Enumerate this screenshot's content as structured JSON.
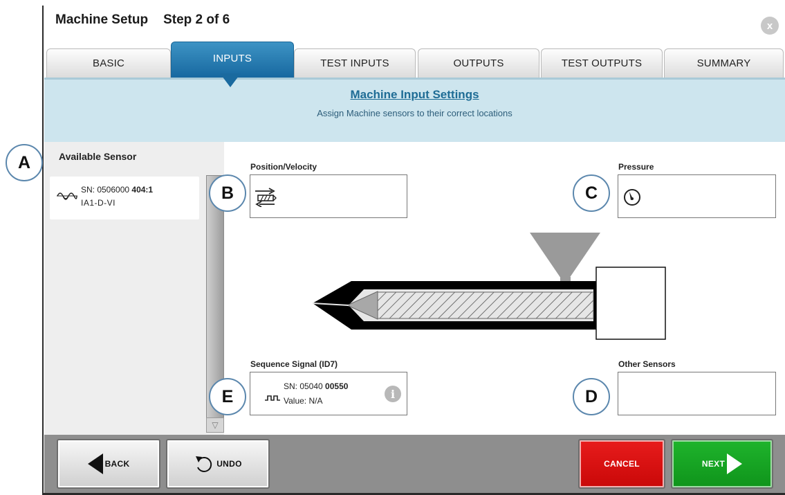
{
  "window": {
    "title": "Machine Setup",
    "step": "Step 2 of 6",
    "close_label": "x"
  },
  "tabs": [
    {
      "label": "BASIC",
      "active": false
    },
    {
      "label": "INPUTS",
      "active": true
    },
    {
      "label": "TEST INPUTS",
      "active": false
    },
    {
      "label": "OUTPUTS",
      "active": false
    },
    {
      "label": "TEST OUTPUTS",
      "active": false
    },
    {
      "label": "SUMMARY",
      "active": false
    }
  ],
  "banner": {
    "title": "Machine Input Settings",
    "subtitle": "Assign Machine sensors to their correct locations"
  },
  "sidebar": {
    "title": "Available Sensor",
    "sensors": [
      {
        "sn_prefix": "SN: 0506000 ",
        "sn_bold": "404:1",
        "code": "IA1-D-VI",
        "icon": "analog-wave-icon"
      }
    ]
  },
  "slots": {
    "position": {
      "label": "Position/Velocity",
      "icon": "position-velocity-icon"
    },
    "pressure": {
      "label": "Pressure",
      "icon": "pressure-gauge-icon"
    },
    "sequence": {
      "label": "Sequence Signal (ID7)",
      "sn_prefix": "SN: 05040 ",
      "sn_bold": "00550",
      "value": "Value: N/A",
      "icon": "digital-pulse-icon",
      "info_icon": "i"
    },
    "other": {
      "label": "Other Sensors"
    }
  },
  "callouts": {
    "a": "A",
    "b": "B",
    "c": "C",
    "d": "D",
    "e": "E"
  },
  "footer": {
    "back_label": "BACK",
    "undo_label": "UNDO",
    "cancel_label": "CANCEL",
    "next_label": "NEXT"
  },
  "colors": {
    "accent_blue": "#1768a0",
    "banner_bg": "#cde5ee",
    "cancel_red": "#d81212",
    "next_green": "#17a624"
  }
}
